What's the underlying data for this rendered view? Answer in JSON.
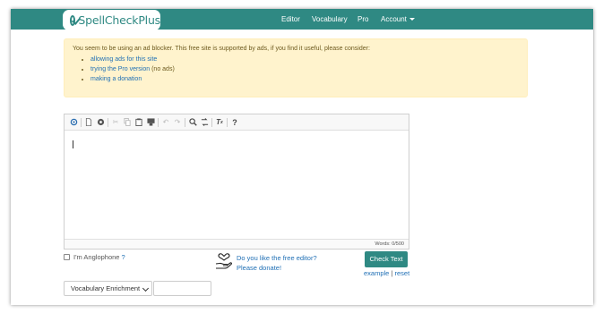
{
  "navbar": {
    "brand": "SpellCheckPlus",
    "items": [
      {
        "label": "Editor"
      },
      {
        "label": "Vocabulary"
      },
      {
        "label": "Pro"
      },
      {
        "label": "Account"
      }
    ],
    "color": "#2f8983"
  },
  "alert": {
    "message": "You seem to be using an ad blocker. This free site is supported by ads, if you find it useful, please consider:",
    "item1": "allowing ads for this site",
    "item2_link": "trying the Pro version",
    "item2_suffix": " (no ads)",
    "item3_link": "making a donation"
  },
  "editor": {
    "toolbar_icons": [
      "spellcheck-icon",
      "new-document-icon",
      "preview-icon",
      "cut-icon",
      "copy-icon",
      "paste-icon",
      "paste-text-icon",
      "undo-icon",
      "redo-icon",
      "find-icon",
      "replace-icon",
      "remove-format-icon",
      "help-icon"
    ],
    "word_count": "Words: 0/500"
  },
  "controls": {
    "anglophone_label": "I'm Anglophone",
    "anglophone_help": "?",
    "promo_line1": "Do you like the free editor?",
    "promo_line2": "Please donate!",
    "check_button": "Check Text",
    "example_link": "example",
    "separator": "|",
    "reset_link": "reset",
    "vocab_select_value": "Vocabulary Enrichment"
  }
}
